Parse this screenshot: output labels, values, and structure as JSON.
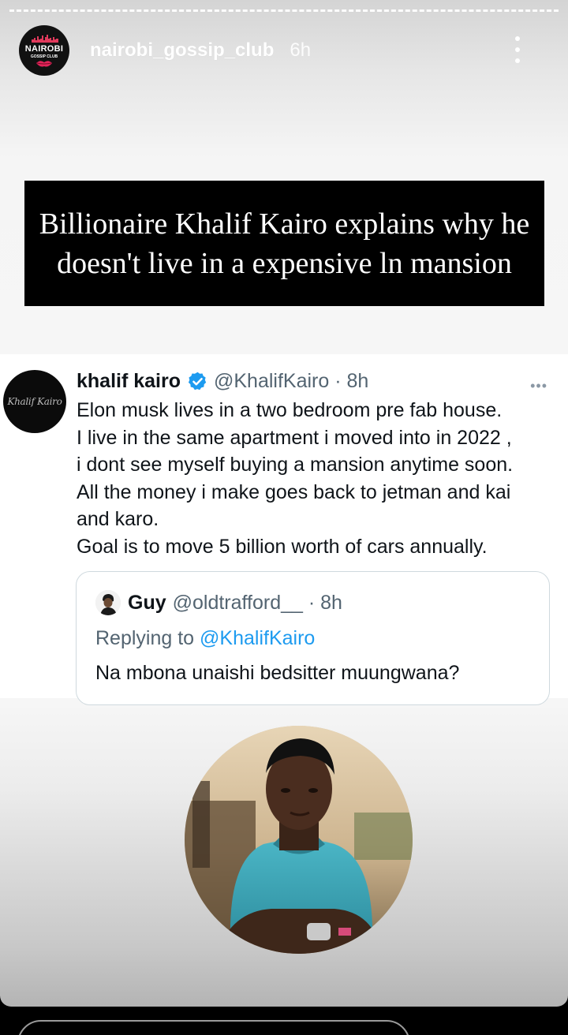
{
  "story": {
    "account": {
      "username": "nairobi_gossip_club",
      "time": "6h",
      "avatar_word": "NAIROBI",
      "avatar_sub": "GOSSIP CLUB"
    },
    "headline": "Billionaire Khalif Kairo explains why he doesn't live in a expensive ln mansion"
  },
  "tweet": {
    "avatar_text": "Khalif Kairo",
    "name": "khalif kairo",
    "handle_time": "@KhalifKairo · 8h",
    "more": "•••",
    "lines": [
      "Elon musk lives in a two bedroom pre fab house.",
      "I live in the same apartment i moved into in 2022 ,",
      "i dont see myself buying a mansion anytime soon.",
      "All the money i make goes back to jetman and kai",
      "and karo.",
      "Goal is to move 5 billion worth of cars annually."
    ]
  },
  "quote": {
    "name": "Guy",
    "handle_time": "@oldtrafford__ · 8h",
    "replying_prefix": "Replying to ",
    "replying_mention": "@KhalifKairo",
    "text": "Na mbona unaishi bedsitter muungwana?"
  },
  "colors": {
    "verified": "#1d9bf0",
    "mention": "#1d9bf0",
    "headline_bg": "#000000"
  },
  "icons": {
    "verified": "verified-badge-icon",
    "menu": "more-vertical-icon"
  }
}
